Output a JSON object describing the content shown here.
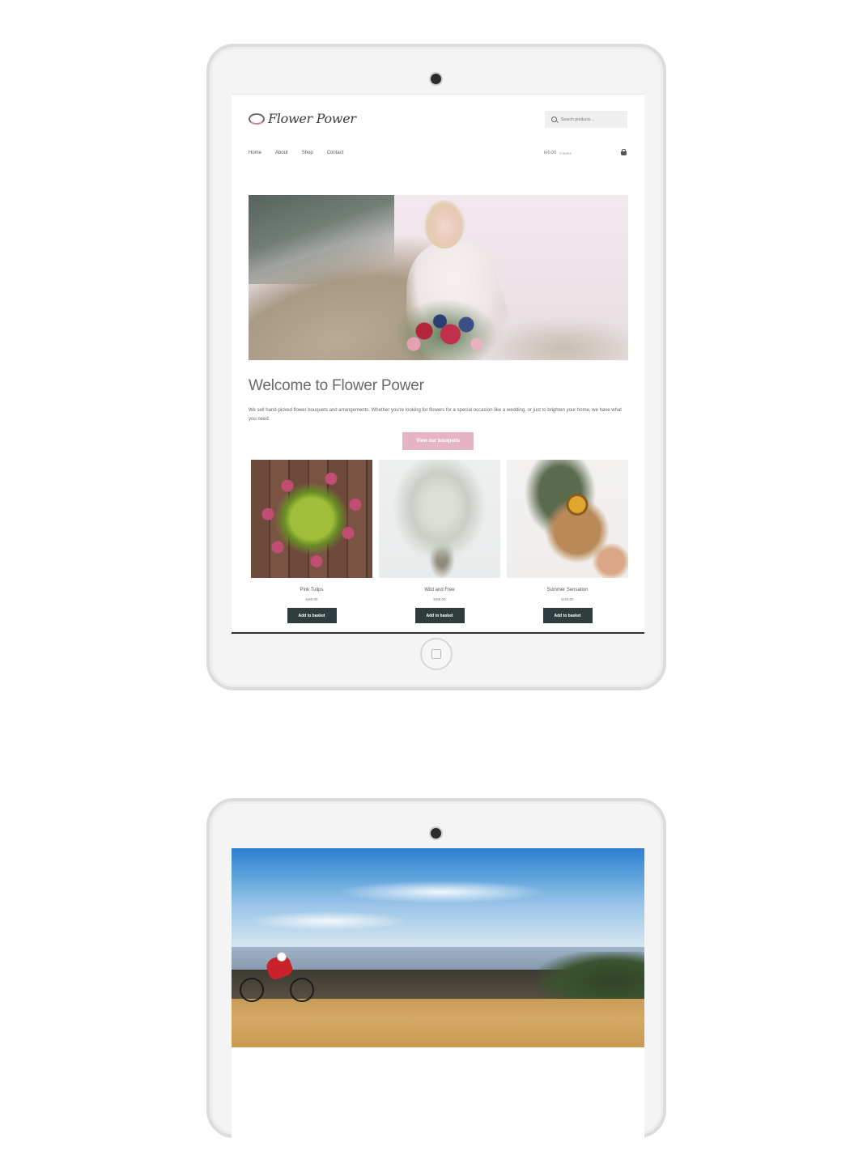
{
  "site": {
    "logo_text": "Flower Power",
    "search_placeholder": "Search products…",
    "nav": [
      "Home",
      "About",
      "Shop",
      "Contact"
    ],
    "cart_total": "kr0.00",
    "cart_count": "0 items"
  },
  "hero": {
    "title": "Welcome to Flower Power",
    "text": "We sell hand-picked flower bouquets and arrangements. Whether you're looking for flowers for a special occasion like a wedding, or just to brighten your home, we have what you need.",
    "cta_label": "View our bouquets"
  },
  "products": [
    {
      "name": "Pink Tulips",
      "price": "kr60.00",
      "button": "Add to basket"
    },
    {
      "name": "Wild and Free",
      "price": "kr65.00",
      "button": "Add to basket"
    },
    {
      "name": "Summer Sensation",
      "price": "kr40.00",
      "button": "Add to basket"
    }
  ],
  "colors": {
    "accent_pink": "#e5b5c4",
    "button_dark": "#2f3c3d",
    "frame": "#dcdcdc"
  },
  "icons": [
    "camera-icon",
    "home-button-icon",
    "search-icon",
    "cart-icon",
    "logo-icon"
  ]
}
